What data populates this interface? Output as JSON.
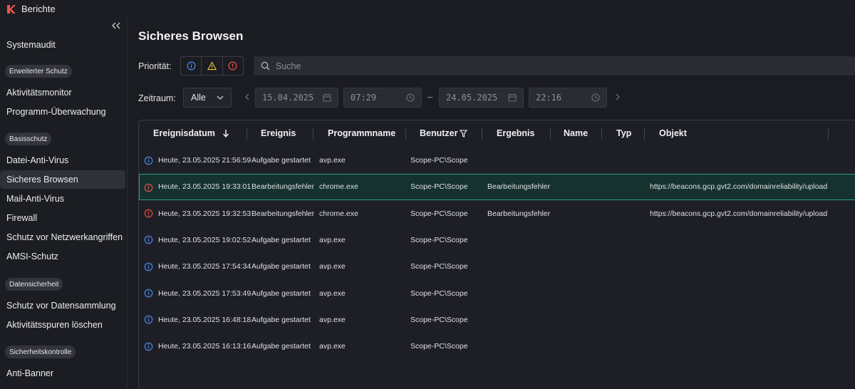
{
  "app": {
    "title": "Berichte"
  },
  "sidebar": {
    "items": [
      {
        "type": "item",
        "label": "Systemaudit"
      },
      {
        "type": "badge",
        "label": "Erweiterter Schutz"
      },
      {
        "type": "item",
        "label": "Aktivitätsmonitor"
      },
      {
        "type": "item",
        "label": "Programm-Überwachung"
      },
      {
        "type": "badge",
        "label": "Basisschutz"
      },
      {
        "type": "item",
        "label": "Datei-Anti-Virus"
      },
      {
        "type": "item",
        "label": "Sicheres Browsen",
        "active": true
      },
      {
        "type": "item",
        "label": "Mail-Anti-Virus"
      },
      {
        "type": "item",
        "label": "Firewall"
      },
      {
        "type": "item",
        "label": "Schutz vor Netzwerkangriffen"
      },
      {
        "type": "item",
        "label": "AMSI-Schutz"
      },
      {
        "type": "badge",
        "label": "Datensicherheit"
      },
      {
        "type": "item",
        "label": "Schutz vor Datensammlung"
      },
      {
        "type": "item",
        "label": "Aktivitätsspuren löschen"
      },
      {
        "type": "badge",
        "label": "Sicherheitskontrolle"
      },
      {
        "type": "item",
        "label": "Anti-Banner"
      }
    ]
  },
  "main": {
    "title": "Sicheres Browsen",
    "priority_label": "Priorität:",
    "search_placeholder": "Suche",
    "period_label": "Zeitraum:",
    "period_value": "Alle",
    "from_date": "15.04.2025",
    "from_time": "07:29",
    "to_date": "24.05.2025",
    "to_time": "22:16",
    "range_dash": "–"
  },
  "table": {
    "columns": [
      "Ereignisdatum",
      "Ereignis",
      "Programmname",
      "Benutzer",
      "Ergebnis",
      "Name",
      "Typ",
      "Objekt"
    ],
    "rows": [
      {
        "status": "info",
        "date": "Heute, 23.05.2025 21:56:59",
        "event": "Aufgabe gestartet",
        "program": "avp.exe",
        "user": "Scope-PC\\Scope",
        "result": "",
        "object": ""
      },
      {
        "status": "error",
        "date": "Heute, 23.05.2025 19:33:01",
        "event": "Bearbeitungsfehler",
        "program": "chrome.exe",
        "user": "Scope-PC\\Scope",
        "result": "Bearbeitungsfehler",
        "object": "https://beacons.gcp.gvt2.com/domainreliability/upload",
        "selected": true
      },
      {
        "status": "error",
        "date": "Heute, 23.05.2025 19:32:53",
        "event": "Bearbeitungsfehler",
        "program": "chrome.exe",
        "user": "Scope-PC\\Scope",
        "result": "Bearbeitungsfehler",
        "object": "https://beacons.gcp.gvt2.com/domainreliability/upload"
      },
      {
        "status": "info",
        "date": "Heute, 23.05.2025 19:02:52",
        "event": "Aufgabe gestartet",
        "program": "avp.exe",
        "user": "Scope-PC\\Scope",
        "result": "",
        "object": ""
      },
      {
        "status": "info",
        "date": "Heute, 23.05.2025 17:54:34",
        "event": "Aufgabe gestartet",
        "program": "avp.exe",
        "user": "Scope-PC\\Scope",
        "result": "",
        "object": ""
      },
      {
        "status": "info",
        "date": "Heute, 23.05.2025 17:53:49",
        "event": "Aufgabe gestartet",
        "program": "avp.exe",
        "user": "Scope-PC\\Scope",
        "result": "",
        "object": ""
      },
      {
        "status": "info",
        "date": "Heute, 23.05.2025 16:48:18",
        "event": "Aufgabe gestartet",
        "program": "avp.exe",
        "user": "Scope-PC\\Scope",
        "result": "",
        "object": ""
      },
      {
        "status": "info",
        "date": "Heute, 23.05.2025 16:13:16",
        "event": "Aufgabe gestartet",
        "program": "avp.exe",
        "user": "Scope-PC\\Scope",
        "result": "",
        "object": ""
      }
    ]
  },
  "colors": {
    "info": "#4f8ef7",
    "warning": "#f2c037",
    "error": "#f0524c",
    "accent": "#2aa07f"
  }
}
